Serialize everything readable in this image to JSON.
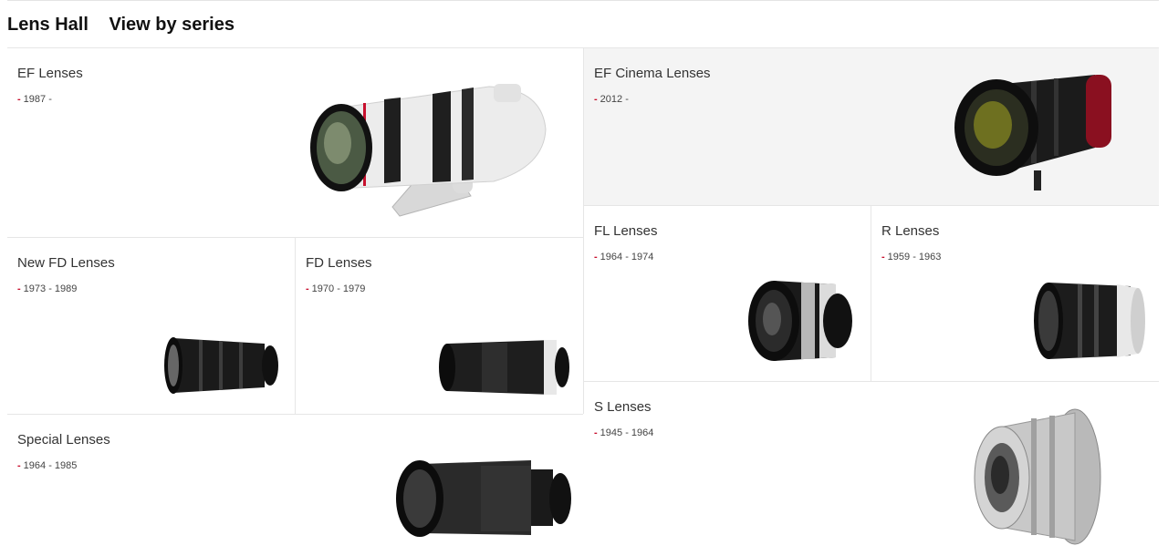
{
  "header": {
    "title": "Lens Hall",
    "subtitle": "View by series"
  },
  "colors": {
    "accent": "#c8102e",
    "tile_grey": "#f4f4f4",
    "divider": "#e6e6e6"
  },
  "series": [
    {
      "id": "ef",
      "name": "EF Lenses",
      "years": "1987 -",
      "icon": "ef-telephoto-lens-image"
    },
    {
      "id": "ef-cinema",
      "name": "EF Cinema Lenses",
      "years": "2012 -",
      "icon": "cinema-zoom-lens-image"
    },
    {
      "id": "fl",
      "name": "FL Lenses",
      "years": "1964 - 1974",
      "icon": "fl-lens-image"
    },
    {
      "id": "r",
      "name": "R Lenses",
      "years": "1959 - 1963",
      "icon": "r-lens-image"
    },
    {
      "id": "new-fd",
      "name": "New FD Lenses",
      "years": "1973 - 1989",
      "icon": "new-fd-lens-image"
    },
    {
      "id": "fd",
      "name": "FD Lenses",
      "years": "1970 - 1979",
      "icon": "fd-lens-image"
    },
    {
      "id": "special",
      "name": "Special Lenses",
      "years": "1964 - 1985",
      "icon": "special-lens-image"
    },
    {
      "id": "s",
      "name": "S Lenses",
      "years": "1945 - 1964",
      "icon": "s-lens-image"
    }
  ]
}
